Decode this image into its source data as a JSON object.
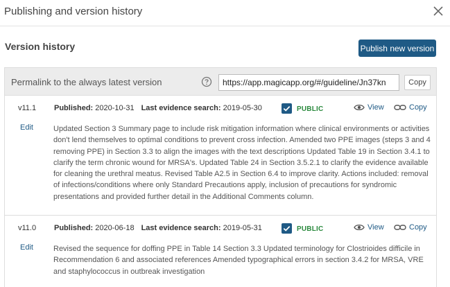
{
  "dialog": {
    "title": "Publishing and version history",
    "close_icon": "close-icon"
  },
  "section": {
    "title": "Version history",
    "publish_button": "Publish new version"
  },
  "permalink": {
    "label": "Permalink to the always latest version",
    "help_icon": "question-circle-icon",
    "url": "https://app.magicapp.org/#/guideline/Jn37kn",
    "copy_button": "Copy"
  },
  "colors": {
    "accent": "#1f5a85",
    "public_green": "#2b8a3e"
  },
  "versions": [
    {
      "version": "v11.1",
      "edit_label": "Edit",
      "published_label": "Published:",
      "published": "2020-10-31",
      "evidence_label": "Last evidence search:",
      "evidence_search": "2019-05-30",
      "public_checked": true,
      "public_label": "PUBLIC",
      "view_label": "View",
      "copy_label": "Copy",
      "description": "Updated Section 3 Summary page to include risk mitigation information where clinical environments or activities don't lend themselves to optimal conditions to prevent cross infection. Amended two PPE images (steps 3 and 4 removing PPE) in Section 3.3 to align the images with the text descriptions Updated Table 19 in Section 3.4.1 to clarify the term chronic wound for MRSA's. Updated Table 24 in Section 3.5.2.1 to clarify the evidence available for cleaning the urethral meatus. Revised Table A2.5 in Section 6.4 to improve clarity. Actions included: removal of infections/conditions where only Standard Precautions apply, inclusion of precautions for syndromic presentations and provided further detail in the Additional Comments column."
    },
    {
      "version": "v11.0",
      "edit_label": "Edit",
      "published_label": "Published:",
      "published": "2020-06-18",
      "evidence_label": "Last evidence search:",
      "evidence_search": "2019-05-31",
      "public_checked": true,
      "public_label": "PUBLIC",
      "view_label": "View",
      "copy_label": "Copy",
      "description": "Revised the sequence for doffing PPE in Table 14 Section 3.3 Updated terminology for Clostrioides difficile in Recommendation 6 and associated references Amended typographical errors in section 3.4.2 for MRSA, VRE and staphylococcus in outbreak investigation"
    }
  ]
}
